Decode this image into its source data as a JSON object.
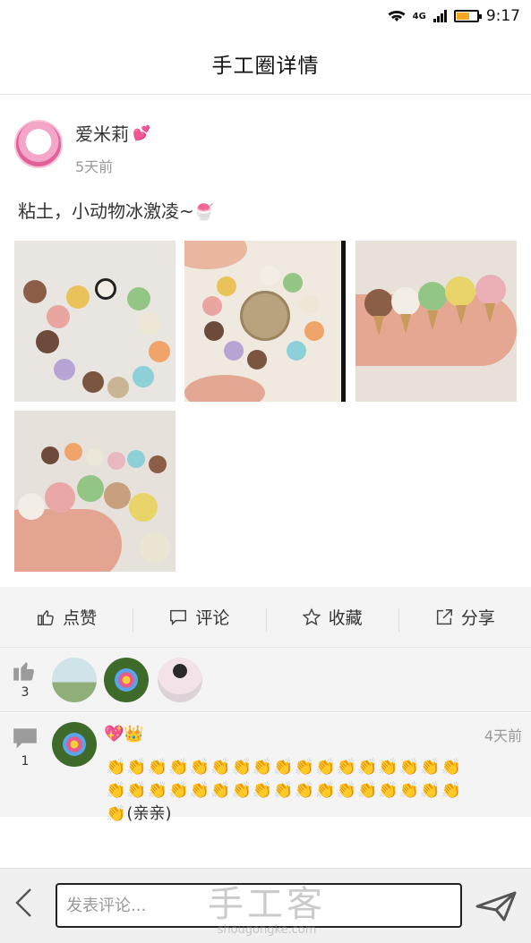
{
  "status_bar": {
    "network": "4G",
    "time": "9:17",
    "battery_level": 0.6
  },
  "header": {
    "title": "手工圈详情"
  },
  "author": {
    "name": "爱米莉",
    "time": "5天前"
  },
  "post": {
    "text": "粘土，小动物冰激凌~"
  },
  "actions": [
    {
      "label": "点赞",
      "icon": "thumbs-up-icon"
    },
    {
      "label": "评论",
      "icon": "comment-icon"
    },
    {
      "label": "收藏",
      "icon": "star-icon"
    },
    {
      "label": "分享",
      "icon": "share-icon"
    }
  ],
  "likes": {
    "count": "3"
  },
  "comment": {
    "count": "1",
    "time": "4天前",
    "user_emoji": "💖👑",
    "emoji_line": "👏👏👏👏👏👏👏👏👏👏👏👏👏👏👏👏👏👏👏👏👏👏👏👏👏👏👏👏👏👏👏👏👏👏👏",
    "text_suffix": "(亲亲)"
  },
  "bottom": {
    "placeholder": "发表评论...",
    "watermark_title": "手工客",
    "watermark_url": "shougongke.com"
  },
  "colors": {
    "accent_pink": "#e8508a",
    "cone": "#c89a5b",
    "panel": "#f4f4f4"
  }
}
